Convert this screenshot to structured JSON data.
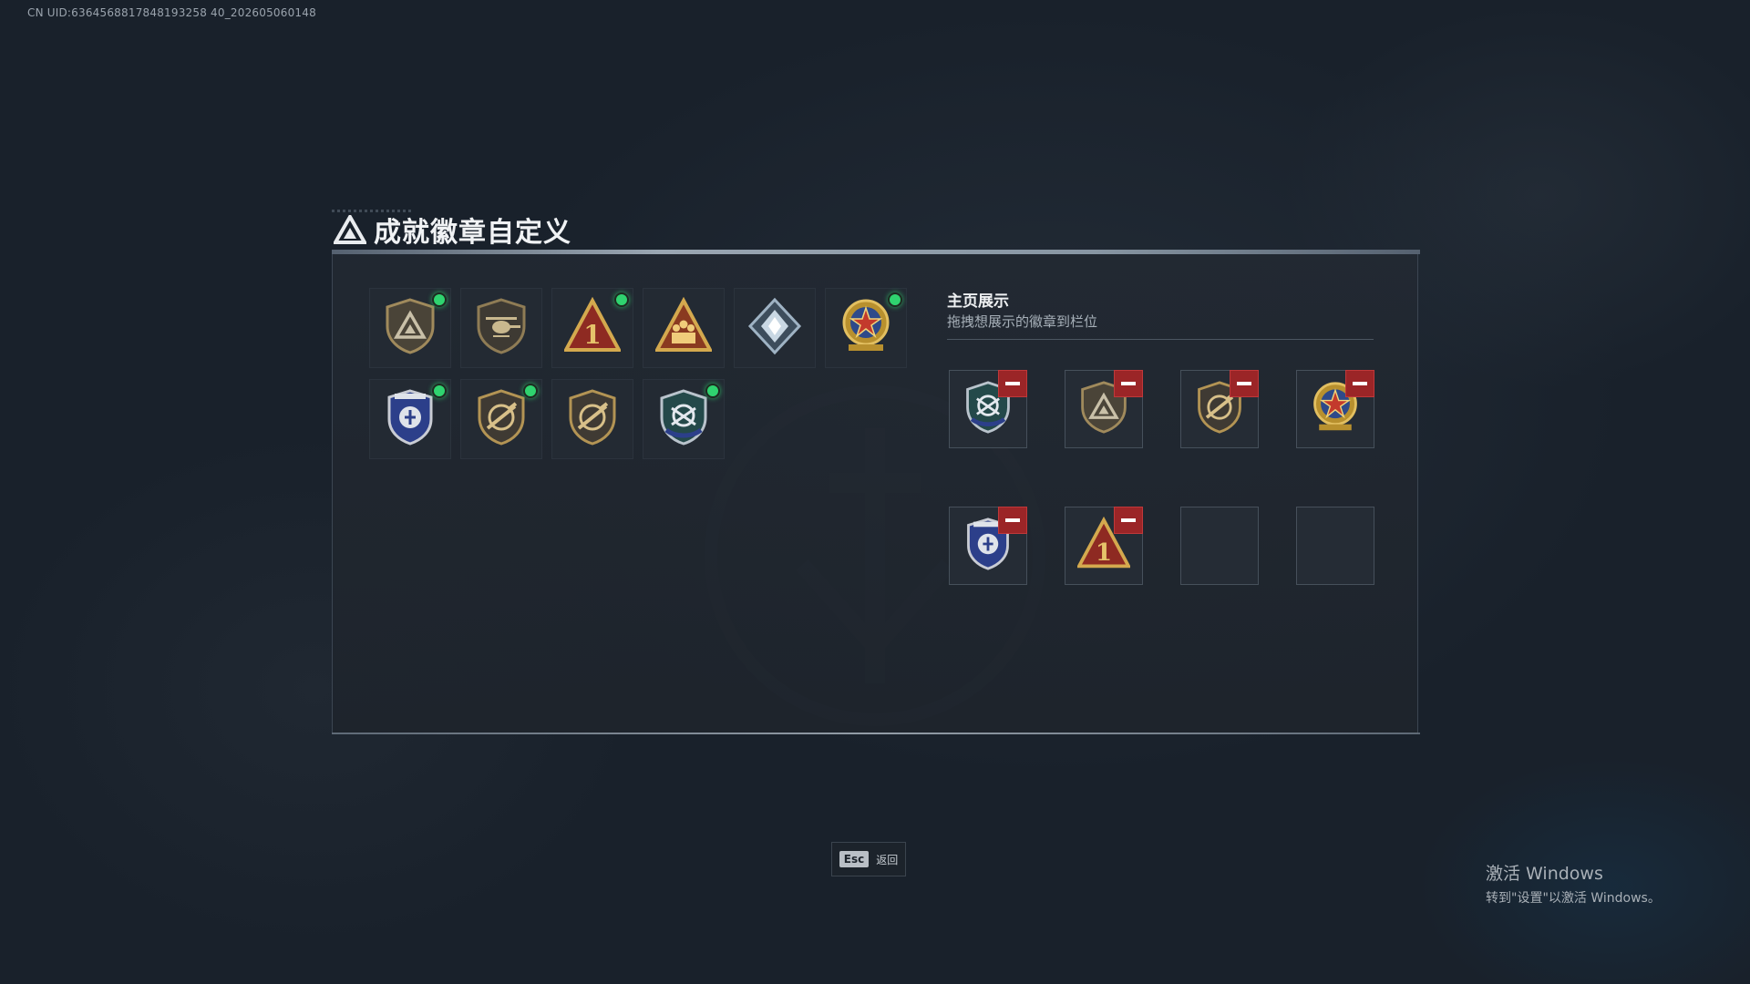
{
  "uid_text": "CN UID:6364568817848193258 40_202605060148",
  "header": {
    "title": "成就徽章自定义"
  },
  "showcase": {
    "title": "主页展示",
    "subtitle": "拖拽想展示的徽章到栏位"
  },
  "collection": [
    {
      "icon": "shield-triangle-badge-icon",
      "selected": true
    },
    {
      "icon": "helicopter-badge-icon",
      "selected": false
    },
    {
      "icon": "number-one-triangle-badge-icon",
      "selected": true
    },
    {
      "icon": "squad-triangle-badge-icon",
      "selected": false
    },
    {
      "icon": "crystal-diamond-badge-icon",
      "selected": false
    },
    {
      "icon": "star-medal-badge-icon",
      "selected": true
    },
    {
      "icon": "blue-police-badge-icon",
      "selected": true
    },
    {
      "icon": "rifle-shield-badge-icon",
      "selected": true
    },
    {
      "icon": "rifle-shield-badge-icon",
      "selected": false
    },
    {
      "icon": "green-wings-shield-badge-icon",
      "selected": true
    }
  ],
  "display_slots": [
    {
      "icon": "green-wings-shield-badge-icon",
      "filled": true
    },
    {
      "icon": "shield-triangle-badge-icon",
      "filled": true
    },
    {
      "icon": "rifle-shield-badge-icon",
      "filled": true
    },
    {
      "icon": "star-medal-badge-icon",
      "filled": true
    },
    {
      "icon": "blue-police-badge-icon",
      "filled": true
    },
    {
      "icon": "number-one-triangle-badge-icon",
      "filled": true
    },
    {
      "icon": "",
      "filled": false
    },
    {
      "icon": "",
      "filled": false
    }
  ],
  "footer": {
    "esc_key": "Esc",
    "esc_label": "返回"
  },
  "windows": {
    "title": "激活 Windows",
    "subtitle": "转到\"设置\"以激活 Windows。"
  },
  "colors": {
    "selected_dot": "#2fd36f",
    "remove_button": "#9b2527",
    "gold": "#c9a24a",
    "red_badge": "#9a2a23"
  }
}
